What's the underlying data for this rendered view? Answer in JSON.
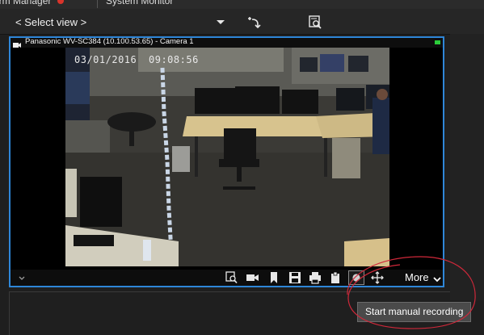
{
  "tabs": [
    {
      "label": "arm Manager"
    },
    {
      "label": "System Monitor"
    }
  ],
  "toolbar": {
    "view_select_label": "< Select view >",
    "icons": [
      "undo-view-icon",
      "search-playback-icon"
    ]
  },
  "camera": {
    "title": "Panasonic WV-SC384 (10.100.53.65) - Camera 1",
    "timestamp_date": "03/01/2016",
    "timestamp_time": "09:08:56",
    "live_color": "#2bcc3a",
    "border_color": "#2e86d8"
  },
  "controls": {
    "icons": [
      "search-icon",
      "video-camera-icon",
      "bookmark-icon",
      "save-icon",
      "print-icon",
      "clipboard-icon",
      "record-icon",
      "ptz-move-icon"
    ],
    "more_label": "More"
  },
  "tooltip": {
    "text": "Start manual recording"
  },
  "annotation": {
    "color": "#d0283a"
  }
}
